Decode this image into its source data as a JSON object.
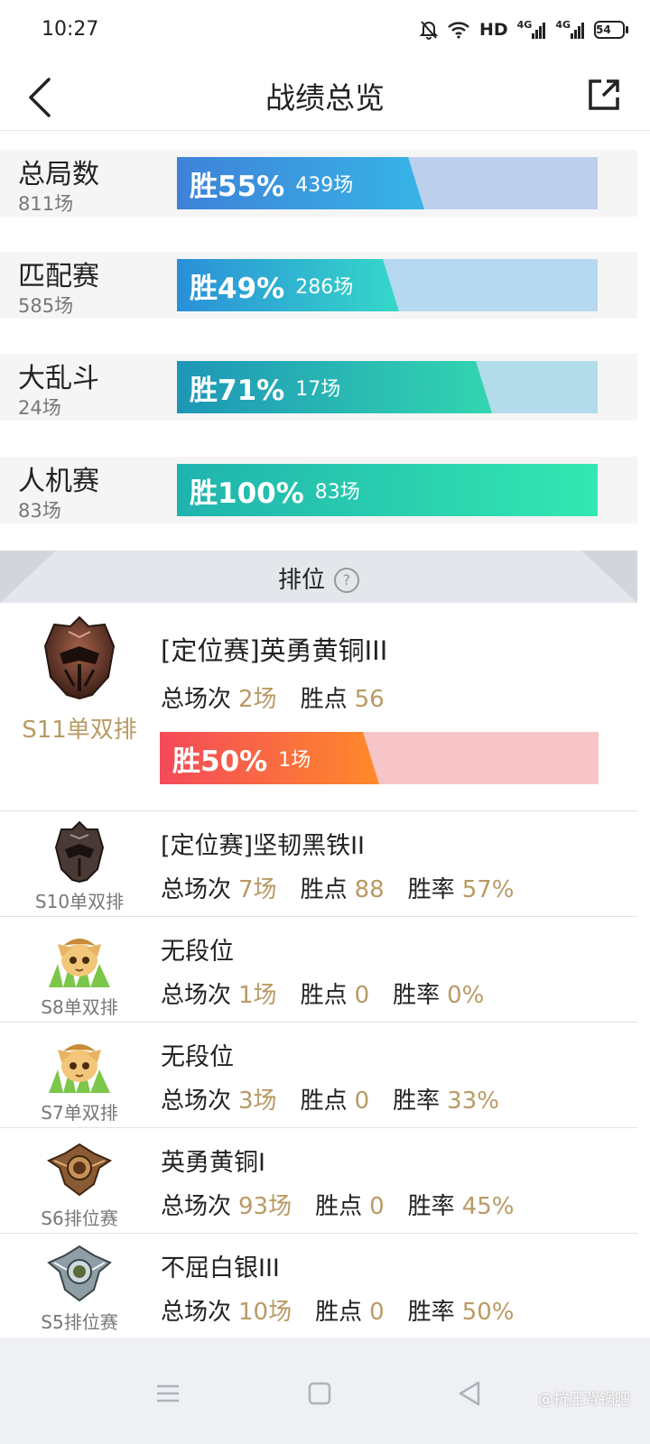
{
  "status_bar": {
    "time": "10:27",
    "network": "HD",
    "sig1": "4G",
    "sig2": "4G",
    "battery": "54"
  },
  "header": {
    "title": "战绩总览"
  },
  "summary": [
    {
      "name": "总局数",
      "count": "811场",
      "win_pct": "胜55%",
      "win_games": "439场",
      "rate": 0.55,
      "gradient": [
        "#3e82d8",
        "#37b4e6"
      ],
      "track": "#bcd0ee"
    },
    {
      "name": "匹配赛",
      "count": "585场",
      "win_pct": "胜49%",
      "win_games": "286场",
      "rate": 0.49,
      "gradient": [
        "#2a8fd9",
        "#35d8c8"
      ],
      "track": "#b6d8f0"
    },
    {
      "name": "大乱斗",
      "count": "24场",
      "win_pct": "胜71%",
      "win_games": "17场",
      "rate": 0.71,
      "gradient": [
        "#1e96b6",
        "#33d6b0"
      ],
      "track": "#b2dcea"
    },
    {
      "name": "人机赛",
      "count": "83场",
      "win_pct": "胜100%",
      "win_games": "83场",
      "rate": 1.0,
      "gradient": [
        "#20b3ae",
        "#33e8b0"
      ],
      "track": "#c0ece0"
    }
  ],
  "ranked": {
    "title": "排位",
    "help_icon": "?",
    "labels": {
      "total": "总场次",
      "lp": "胜点",
      "winrate": "胜率"
    },
    "current": {
      "season": "S11单双排",
      "rank": "[定位赛]英勇黄铜III",
      "total": "2场",
      "lp": "56",
      "win_pct": "胜50%",
      "win_games": "1场",
      "rate": 0.5,
      "gradient": [
        "#f44a5a",
        "#ff8a2a"
      ],
      "track": "#f7c4c7"
    },
    "seasons": [
      {
        "season": "S10单双排",
        "rank": "[定位赛]坚韧黑铁II",
        "total": "7场",
        "lp": "88",
        "winrate": "57%",
        "emblem": "iron-emblem"
      },
      {
        "season": "S8单双排",
        "rank": "无段位",
        "total": "1场",
        "lp": "0",
        "winrate": "0%",
        "emblem": "teemo-emblem"
      },
      {
        "season": "S7单双排",
        "rank": "无段位",
        "total": "3场",
        "lp": "0",
        "winrate": "33%",
        "emblem": "teemo-emblem"
      },
      {
        "season": "S6排位赛",
        "rank": "英勇黄铜I",
        "total": "93场",
        "lp": "0",
        "winrate": "45%",
        "emblem": "bronze-emblem"
      },
      {
        "season": "S5排位赛",
        "rank": "不屈白银III",
        "total": "10场",
        "lp": "0",
        "winrate": "50%",
        "emblem": "silver-emblem"
      }
    ]
  },
  "watermark": "@抗压背锅吧",
  "colors": {
    "accent_value": "#b99a64",
    "season_highlight": "#b99a64"
  }
}
